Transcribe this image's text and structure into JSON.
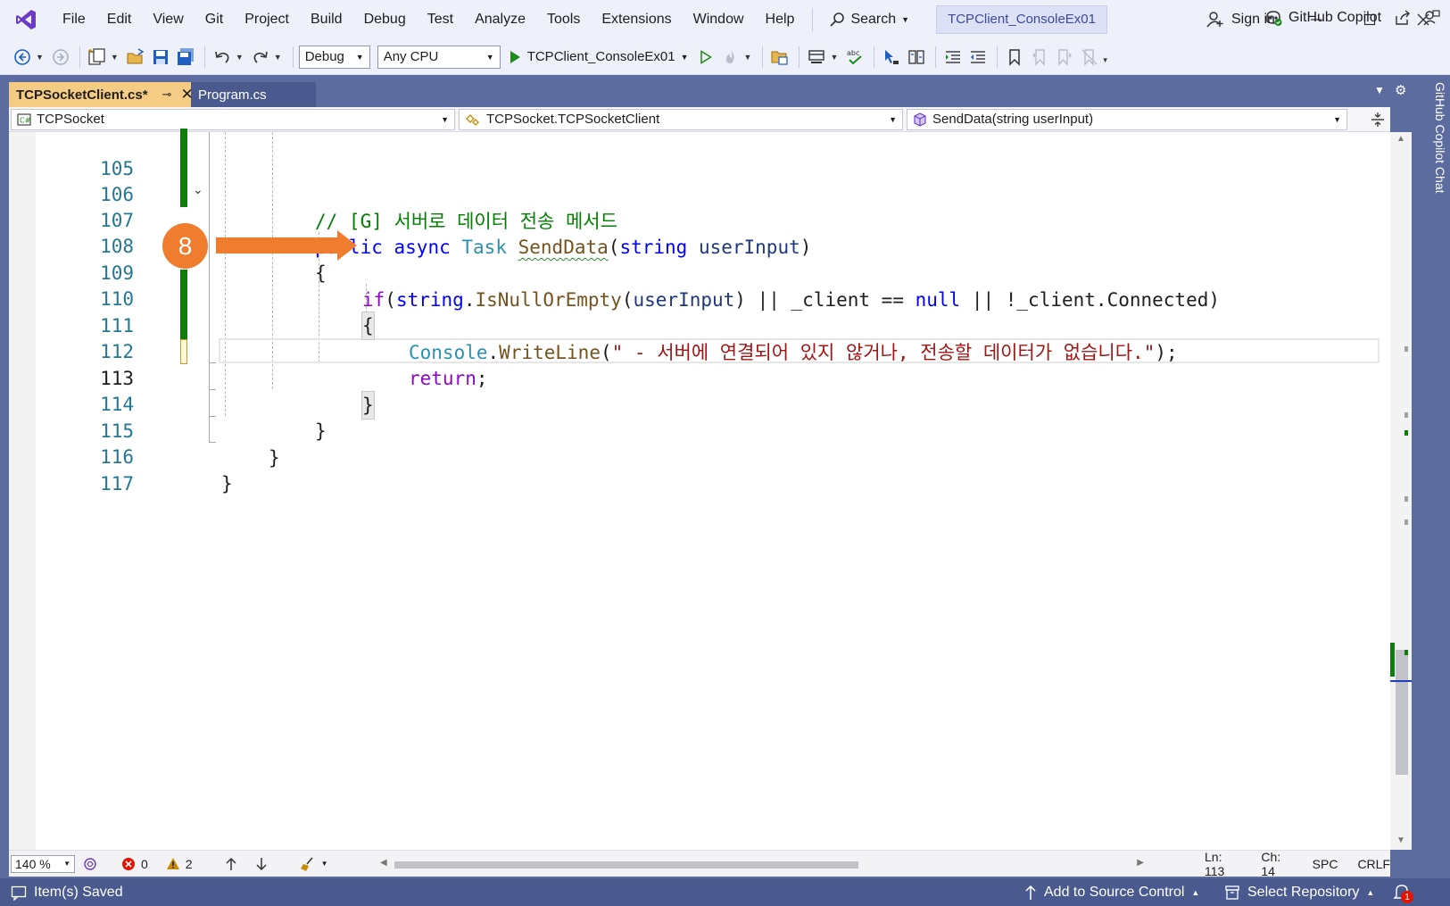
{
  "menu": {
    "items": [
      "File",
      "Edit",
      "View",
      "Git",
      "Project",
      "Build",
      "Debug",
      "Test",
      "Analyze",
      "Tools",
      "Extensions",
      "Window",
      "Help"
    ],
    "search_label": "Search",
    "solution_name": "TCPClient_ConsoleEx01",
    "sign_in": "Sign in"
  },
  "toolbar": {
    "configuration": "Debug",
    "platform": "Any CPU",
    "startup_project": "TCPClient_ConsoleEx01",
    "copilot_label": "GitHub Copilot"
  },
  "tabs": [
    {
      "label": "TCPSocketClient.cs*",
      "active": true
    },
    {
      "label": "Program.cs",
      "active": false
    }
  ],
  "navbar": {
    "project": "TCPSocket",
    "type": "TCPSocket.TCPSocketClient",
    "member": "SendData(string userInput)"
  },
  "code": {
    "line_numbers": [
      "105",
      "106",
      "107",
      "108",
      "109",
      "110",
      "111",
      "112",
      "113",
      "114",
      "115",
      "116",
      "117"
    ],
    "current_line": "113",
    "comment_106": "// [G] 서버로 데이터 전송 메서드",
    "kw_public": "public",
    "kw_async": "async",
    "type_task": "Task",
    "method_senddata": "SendData",
    "kw_string": "string",
    "param_userinput": "userInput",
    "kw_if": "if",
    "method_isnullorempty": "IsNullOrEmpty",
    "field_client": "_client",
    "kw_null": "null",
    "prop_connected": "Connected",
    "type_console": "Console",
    "method_writeline": "WriteLine",
    "string_111": "\" - 서버에 연결되어 있지 않거나, 전송할 데이터가 없습니다.\"",
    "kw_return": "return"
  },
  "callout": {
    "number": "8",
    "color": "#ef7d2d"
  },
  "editor_status": {
    "zoom": "140 %",
    "errors": "0",
    "warnings": "2",
    "ln": "Ln: 113",
    "ch": "Ch: 14",
    "indent": "SPC",
    "line_ending": "CRLF"
  },
  "side_panel": {
    "label": "GitHub Copilot Chat"
  },
  "statusbar": {
    "message": "Item(s) Saved",
    "source_control": "Add to Source Control",
    "repository": "Select Repository",
    "notifications": "1"
  },
  "colors": {
    "active_tab": "#f5cc84",
    "well": "#5d6c9e",
    "statusbar": "#4a5a8e",
    "change_bar": "#107c10",
    "keyword": "#0000ff",
    "type": "#2b91af",
    "string": "#a31515",
    "comment": "#008000"
  }
}
